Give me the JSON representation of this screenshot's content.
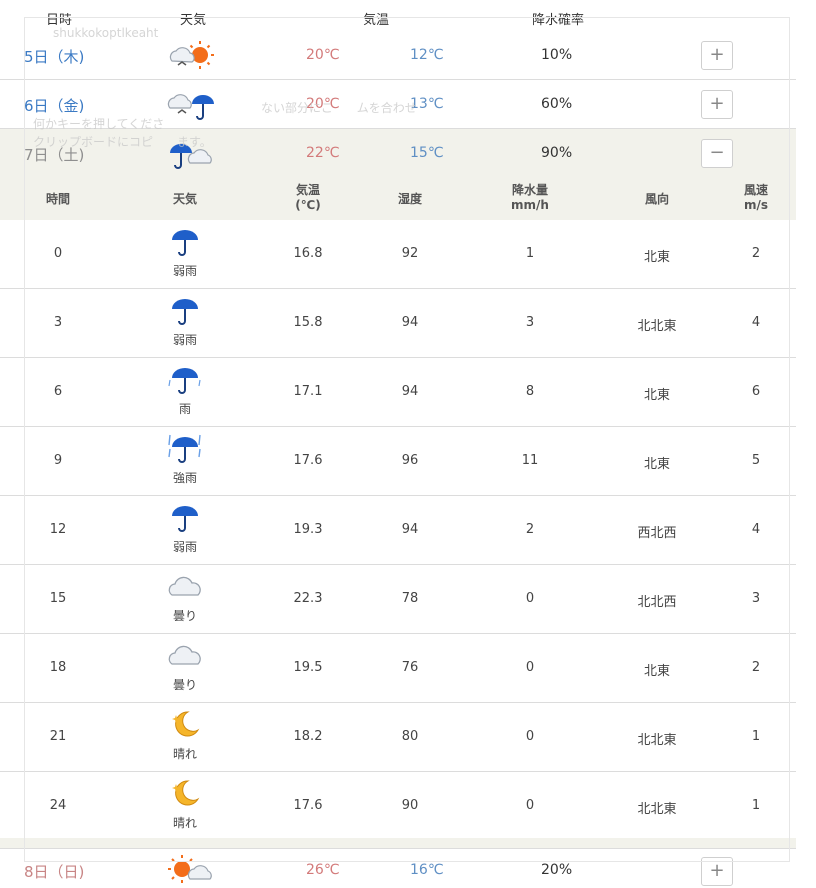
{
  "header": {
    "date": "日時",
    "weather": "天気",
    "temp": "気温",
    "pop": "降水確率"
  },
  "days": [
    {
      "date": "5日（木)",
      "hi": "20℃",
      "lo": "12℃",
      "pop": "10%",
      "toggle": "+",
      "icon": "cloud-sun-icon"
    },
    {
      "date": "6日（金)",
      "hi": "20℃",
      "lo": "13℃",
      "pop": "60%",
      "toggle": "+",
      "icon": "cloud-umbrella-icon"
    },
    {
      "date": "7日（土)",
      "hi": "22℃",
      "lo": "15℃",
      "pop": "90%",
      "toggle": "−",
      "icon": "umbrella-cloud-icon"
    },
    {
      "date": "8日（日)",
      "hi": "26℃",
      "lo": "16℃",
      "pop": "20%",
      "toggle": "+",
      "icon": "sun-cloud-icon"
    }
  ],
  "hourly_header": {
    "time": "時間",
    "weather": "天気",
    "temp_1": "気温",
    "temp_2": "(℃)",
    "humidity": "湿度",
    "rain_1": "降水量",
    "rain_2": "mm/h",
    "wind_dir": "風向",
    "wind_1": "風速",
    "wind_2": "m/s"
  },
  "hourly": [
    {
      "time": "0",
      "weather": "弱雨",
      "icon": "umbrella-icon",
      "temp": "16.8",
      "humidity": "92",
      "rain": "1",
      "dir": "北東",
      "wind": "2"
    },
    {
      "time": "3",
      "weather": "弱雨",
      "icon": "umbrella-icon",
      "temp": "15.8",
      "humidity": "94",
      "rain": "3",
      "dir": "北北東",
      "wind": "4"
    },
    {
      "time": "6",
      "weather": "雨",
      "icon": "umbrella-rain-icon",
      "temp": "17.1",
      "humidity": "94",
      "rain": "8",
      "dir": "北東",
      "wind": "6"
    },
    {
      "time": "9",
      "weather": "強雨",
      "icon": "umbrella-heavy-icon",
      "temp": "17.6",
      "humidity": "96",
      "rain": "11",
      "dir": "北東",
      "wind": "5"
    },
    {
      "time": "12",
      "weather": "弱雨",
      "icon": "umbrella-icon",
      "temp": "19.3",
      "humidity": "94",
      "rain": "2",
      "dir": "西北西",
      "wind": "4"
    },
    {
      "time": "15",
      "weather": "曇り",
      "icon": "cloud-icon",
      "temp": "22.3",
      "humidity": "78",
      "rain": "0",
      "dir": "北北西",
      "wind": "3"
    },
    {
      "time": "18",
      "weather": "曇り",
      "icon": "cloud-icon",
      "temp": "19.5",
      "humidity": "76",
      "rain": "0",
      "dir": "北東",
      "wind": "2"
    },
    {
      "time": "21",
      "weather": "晴れ",
      "icon": "moon-icon",
      "temp": "18.2",
      "humidity": "80",
      "rain": "0",
      "dir": "北北東",
      "wind": "1"
    },
    {
      "time": "24",
      "weather": "晴れ",
      "icon": "moon-icon",
      "temp": "17.6",
      "humidity": "90",
      "rain": "0",
      "dir": "北北東",
      "wind": "1"
    }
  ],
  "ghost_overlay": {
    "line1": "shukkokoptlkeaht",
    "line2": "ない部分にこ　　ムを合わせ",
    "line3": "何かキーを押してくださ",
    "line4": "クリップボードにコピ　　ます。"
  },
  "colors": {
    "weekday": "#3b7ac4",
    "weekend": "#c88585",
    "temp_high": "#d37a7a",
    "temp_low": "#5f8fc4",
    "expanded_bg": "#f2f2eb"
  }
}
